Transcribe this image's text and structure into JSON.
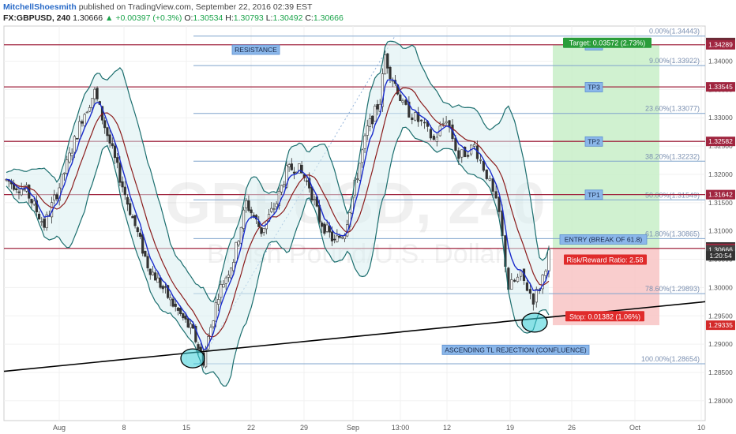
{
  "header": {
    "author": "MitchellShoesmith",
    "published": "published on TradingView.com, September 22, 2016 02:39 EST",
    "symbol": "FX:GBPUSD, 240",
    "last": "1.30666",
    "change": "▲ +0.00397 (+0.3%)",
    "o_label": "O:",
    "o": "1.30534",
    "h_label": "H:",
    "h": "1.30793",
    "l_label": "L:",
    "l": "1.30492",
    "c_label": "C:",
    "c": "1.30666"
  },
  "watermark": {
    "symbol": "GBPUSD, 240",
    "name": "British Pound/U.S. Dollar"
  },
  "colors": {
    "resistance": "#a0253f",
    "fib": "#7fa3cc",
    "target_zone": "#c8efc8",
    "stop_zone": "#f8c4c4",
    "bollinger": "#1b6e6e",
    "sma": "#8b1c1c",
    "ema": "#1a2ccc",
    "candle": "#333333"
  },
  "chart_data": {
    "type": "candlestick",
    "title": "FX:GBPUSD, 240",
    "xlabel": "",
    "ylabel": "",
    "ylim": [
      1.2765,
      1.3462
    ],
    "x_ticks": [
      "Aug",
      "8",
      "15",
      "22",
      "29",
      "Sep",
      "13:00",
      "12",
      "19",
      "26",
      "Oct",
      "10"
    ],
    "y_ticks": [
      "1.34000",
      "1.33500",
      "1.33000",
      "1.32500",
      "1.32000",
      "1.31500",
      "1.31000",
      "1.30500",
      "1.30000",
      "1.29500",
      "1.29000",
      "1.28500",
      "1.28000"
    ],
    "price_tags": [
      {
        "value": "1.34329",
        "y": 1.34329,
        "color": "#6b2a36"
      },
      {
        "value": "1.34289",
        "y": 1.34289,
        "color": "#a0253f"
      },
      {
        "value": "1.33545",
        "y": 1.33545,
        "color": "#a0253f"
      },
      {
        "value": "1.32582",
        "y": 1.32582,
        "color": "#a0253f"
      },
      {
        "value": "1.31642",
        "y": 1.31642,
        "color": "#a0253f"
      },
      {
        "value": "1.30717",
        "y": 1.30717,
        "color": "#333333"
      },
      {
        "value": "1.30692",
        "y": 1.30692,
        "color": "#a0253f"
      },
      {
        "value": "1.30666",
        "y": 1.30666,
        "color": "#444444"
      },
      {
        "value": "1:20:54",
        "y": 1.3056,
        "color": "#333333"
      },
      {
        "value": "1.29335",
        "y": 1.29335,
        "color": "#d32a2a"
      }
    ],
    "resistance_lines": [
      1.34289,
      1.33545,
      1.32582,
      1.31642,
      1.30692
    ],
    "fib_levels": [
      {
        "label": "0.00%(1.34443)",
        "y": 1.34443
      },
      {
        "label": "9.00%(1.33922)",
        "y": 1.33922
      },
      {
        "label": "23.60%(1.33077)",
        "y": 1.33077
      },
      {
        "label": "38.20%(1.32232)",
        "y": 1.32232
      },
      {
        "label": "50.00%(1.31549)",
        "y": 1.31549
      },
      {
        "label": "61.80%(1.30865)",
        "y": 1.30865
      },
      {
        "label": "78.60%(1.29893)",
        "y": 1.29893
      },
      {
        "label": "100.00%(1.28654)",
        "y": 1.28654
      }
    ],
    "tp_labels": [
      {
        "label": "TP4",
        "y": 1.3428
      },
      {
        "label": "TP3",
        "y": 1.3354
      },
      {
        "label": "TP2",
        "y": 1.3258
      },
      {
        "label": "TP1",
        "y": 1.3164
      }
    ],
    "annotations": {
      "resistance": "RESISTANCE",
      "target": "Target: 0.03572 (2.73%)",
      "entry": "ENTRY (BREAK OF 61.8)",
      "rr": "Risk/Reward Ratio: 2.58",
      "stop": "Stop: 0.01382 (1.06%)",
      "trendline": "ASCENDING TL REJECTION (CONFLUENCE)"
    },
    "position": {
      "entry": 1.3069,
      "target": 1.34289,
      "stop": 1.29335
    },
    "trendline": {
      "from": [
        0,
        1.2852
      ],
      "to": [
        1,
        1.2975
      ]
    }
  }
}
